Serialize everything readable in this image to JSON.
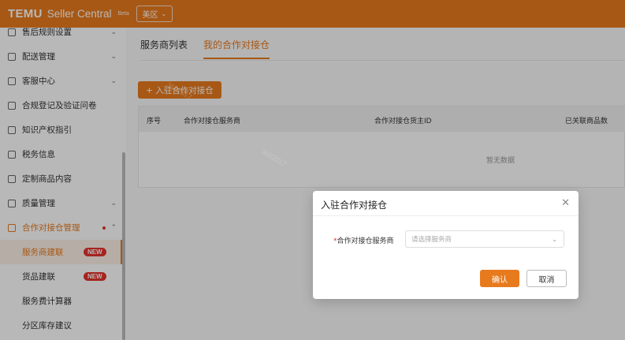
{
  "header": {
    "brand": "TEMU",
    "brand_sub": "Seller Central",
    "beta": "Beta",
    "region": "美区",
    "region_icon": "chevron-down-icon"
  },
  "sidebar": {
    "items": [
      {
        "label": "售后规则设置",
        "icon": "refund-icon",
        "expandable": true
      },
      {
        "label": "配送管理",
        "icon": "truck-icon",
        "expandable": true
      },
      {
        "label": "客服中心",
        "icon": "chat-icon",
        "expandable": true
      },
      {
        "label": "合规登记及验证问卷",
        "icon": "document-icon",
        "expandable": false
      },
      {
        "label": "知识产权指引",
        "icon": "book-icon",
        "expandable": false
      },
      {
        "label": "税务信息",
        "icon": "tax-icon",
        "expandable": false
      },
      {
        "label": "定制商品内容",
        "icon": "edit-icon",
        "expandable": false
      },
      {
        "label": "质量管理",
        "icon": "shield-icon",
        "expandable": true
      },
      {
        "label": "合作对接仓管理",
        "icon": "warehouse-icon",
        "expandable": true,
        "active": true
      }
    ],
    "sub_items": [
      {
        "label": "服务商建联",
        "badge": "NEW",
        "selected": true
      },
      {
        "label": "货品建联",
        "badge": "NEW",
        "selected": false
      },
      {
        "label": "服务费计算器",
        "badge": "",
        "selected": false
      },
      {
        "label": "分区库存建议",
        "badge": "",
        "selected": false
      }
    ]
  },
  "main": {
    "tabs": [
      {
        "label": "服务商列表",
        "active": false
      },
      {
        "label": "我的合作对接仓",
        "active": true
      }
    ],
    "add_button": "+ 入驻合作对接仓",
    "table": {
      "columns": [
        "序号",
        "合作对接仓服务商",
        "合作对接仓货主ID",
        "已关联商品数"
      ],
      "empty_text": "暂无数据"
    }
  },
  "modal": {
    "title": "入驻合作对接仓",
    "field_required_mark": "*",
    "field_label": "合作对接仓服务商",
    "select_placeholder": "请选择服务商",
    "confirm": "确认",
    "cancel": "取消"
  },
  "colors": {
    "brand": "#e87a1e",
    "badge": "#e5322b"
  }
}
